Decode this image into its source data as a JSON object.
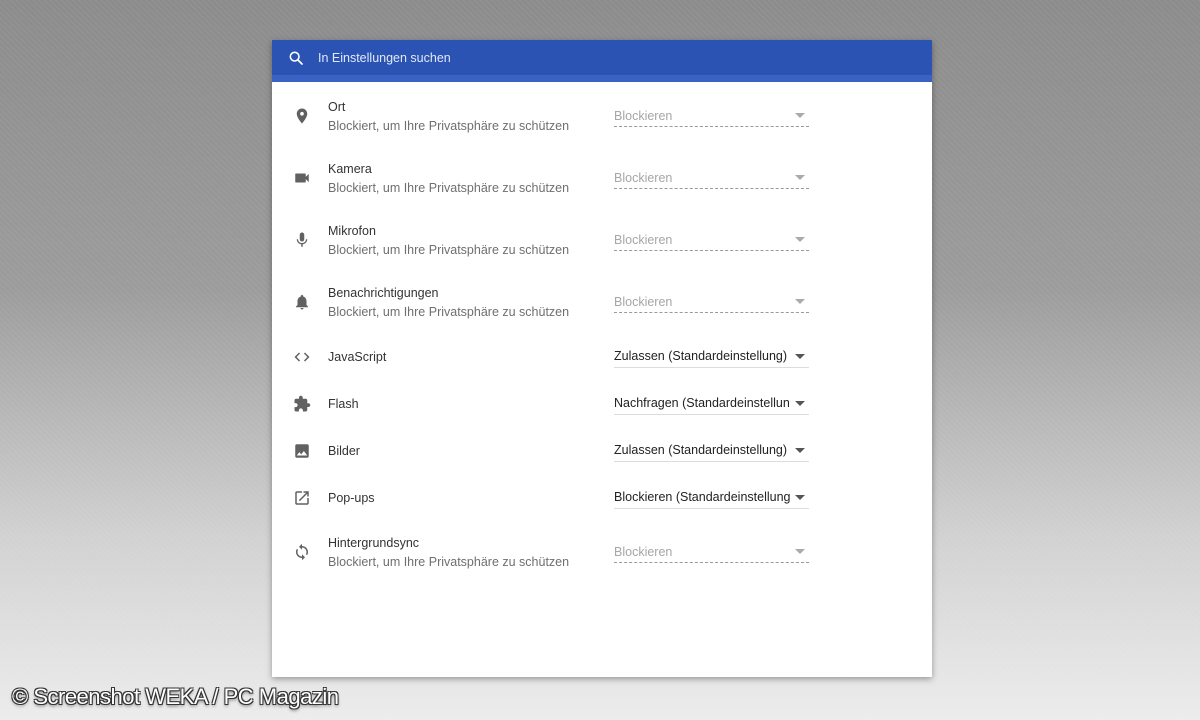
{
  "search": {
    "placeholder": "In Einstellungen suchen"
  },
  "rows": [
    {
      "icon": "location-pin-icon",
      "title": "Ort",
      "subtitle": "Blockiert, um Ihre Privatsphäre zu schützen",
      "value": "Blockieren",
      "disabled": true
    },
    {
      "icon": "camera-icon",
      "title": "Kamera",
      "subtitle": "Blockiert, um Ihre Privatsphäre zu schützen",
      "value": "Blockieren",
      "disabled": true
    },
    {
      "icon": "microphone-icon",
      "title": "Mikrofon",
      "subtitle": "Blockiert, um Ihre Privatsphäre zu schützen",
      "value": "Blockieren",
      "disabled": true
    },
    {
      "icon": "bell-icon",
      "title": "Benachrichtigungen",
      "subtitle": "Blockiert, um Ihre Privatsphäre zu schützen",
      "value": "Blockieren",
      "disabled": true
    },
    {
      "icon": "code-icon",
      "title": "JavaScript",
      "value": "Zulassen (Standardeinstellung)",
      "disabled": false
    },
    {
      "icon": "puzzle-piece-icon",
      "title": "Flash",
      "value": "Nachfragen (Standardeinstellung)",
      "disabled": false
    },
    {
      "icon": "image-icon",
      "title": "Bilder",
      "value": "Zulassen (Standardeinstellung)",
      "disabled": false
    },
    {
      "icon": "open-in-new-icon",
      "title": "Pop-ups",
      "value": "Blockieren (Standardeinstellung)",
      "disabled": false
    },
    {
      "icon": "sync-icon",
      "title": "Hintergrundsync",
      "subtitle": "Blockiert, um Ihre Privatsphäre zu schützen",
      "value": "Blockieren",
      "disabled": true
    }
  ],
  "watermark": "© Screenshot WEKA / PC Magazin",
  "colors": {
    "header": "#2a53b3",
    "icon": "#616161",
    "background": "#ffffff"
  }
}
